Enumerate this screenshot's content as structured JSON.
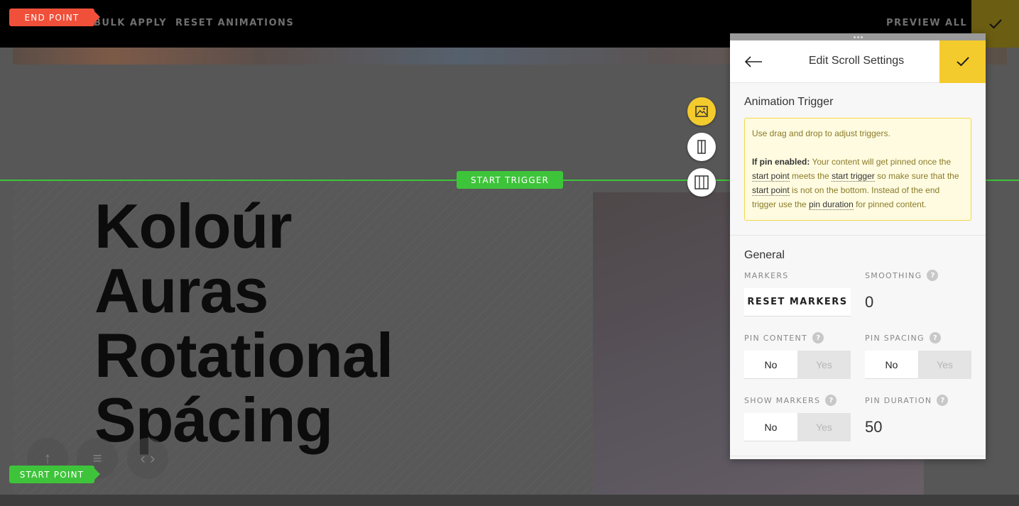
{
  "toolbar": {
    "bulk_apply": "BULK APPLY",
    "reset_animations": "RESET ANIMATIONS",
    "preview_all": "PREVIEW ALL"
  },
  "markers": {
    "end_point": "END POINT",
    "start_point": "START POINT",
    "start_trigger": "START TRIGGER"
  },
  "hero": {
    "line1": "Koloúr",
    "line2": "Auras",
    "line3": "Rotational",
    "line4": "Spácing"
  },
  "panel": {
    "title": "Edit Scroll Settings",
    "trigger_section": {
      "title": "Animation Trigger",
      "info_line1": "Use drag and drop to adjust triggers.",
      "pin_label": "If pin enabled:",
      "t1": " Your content will get pinned once the ",
      "start_point": "start point",
      "t2": " meets the ",
      "start_trigger": "start trigger",
      "t3": " so make sure that the ",
      "start_point_2": "start point",
      "t4": " is not on the bottom. Instead of the end trigger use the ",
      "pin_duration": "pin duration",
      "t5": " for pinned content."
    },
    "general": {
      "title": "General",
      "markers_label": "MARKERS",
      "reset_markers": "RESET MARKERS",
      "smoothing_label": "SMOOTHING",
      "smoothing_value": "0",
      "pin_content_label": "PIN CONTENT",
      "pin_spacing_label": "PIN SPACING",
      "show_markers_label": "SHOW MARKERS",
      "pin_duration_label": "PIN DURATION",
      "pin_duration_value": "50",
      "no": "No",
      "yes": "Yes",
      "help": "?"
    }
  },
  "colors": {
    "accent_yellow": "#f4cb2c",
    "trigger_green": "#3ec43a",
    "end_red": "#f0503a"
  }
}
